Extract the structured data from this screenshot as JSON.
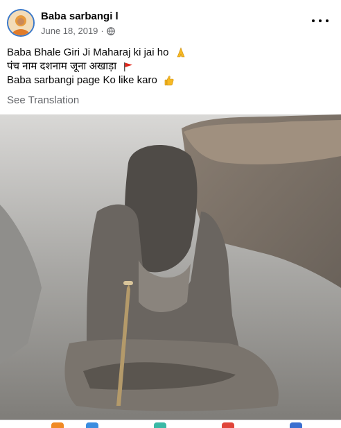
{
  "post": {
    "author": "Baba sarbangi l",
    "date": "June 18, 2019",
    "separator": "·",
    "audience_icon": "globe-icon",
    "more_icon": "more-options-icon",
    "lines": [
      "Baba Bhale Giri Ji Maharaj ki jai ho",
      "पंच नाम दशनाम जूना अखाड़ा",
      "Baba sarbangi page Ko like karo"
    ],
    "line_emoji_icons": [
      "folded-hands-icon",
      "red-flag-icon",
      "thumbs-up-icon"
    ],
    "see_translation": "See Translation",
    "image_alt_icon": "ash-covered-sadhu-photo"
  },
  "colors": {
    "meta_text": "#65676b",
    "primary_text": "#050505",
    "flag": "#e0261b",
    "emoji_yellow": "#f7b924"
  }
}
